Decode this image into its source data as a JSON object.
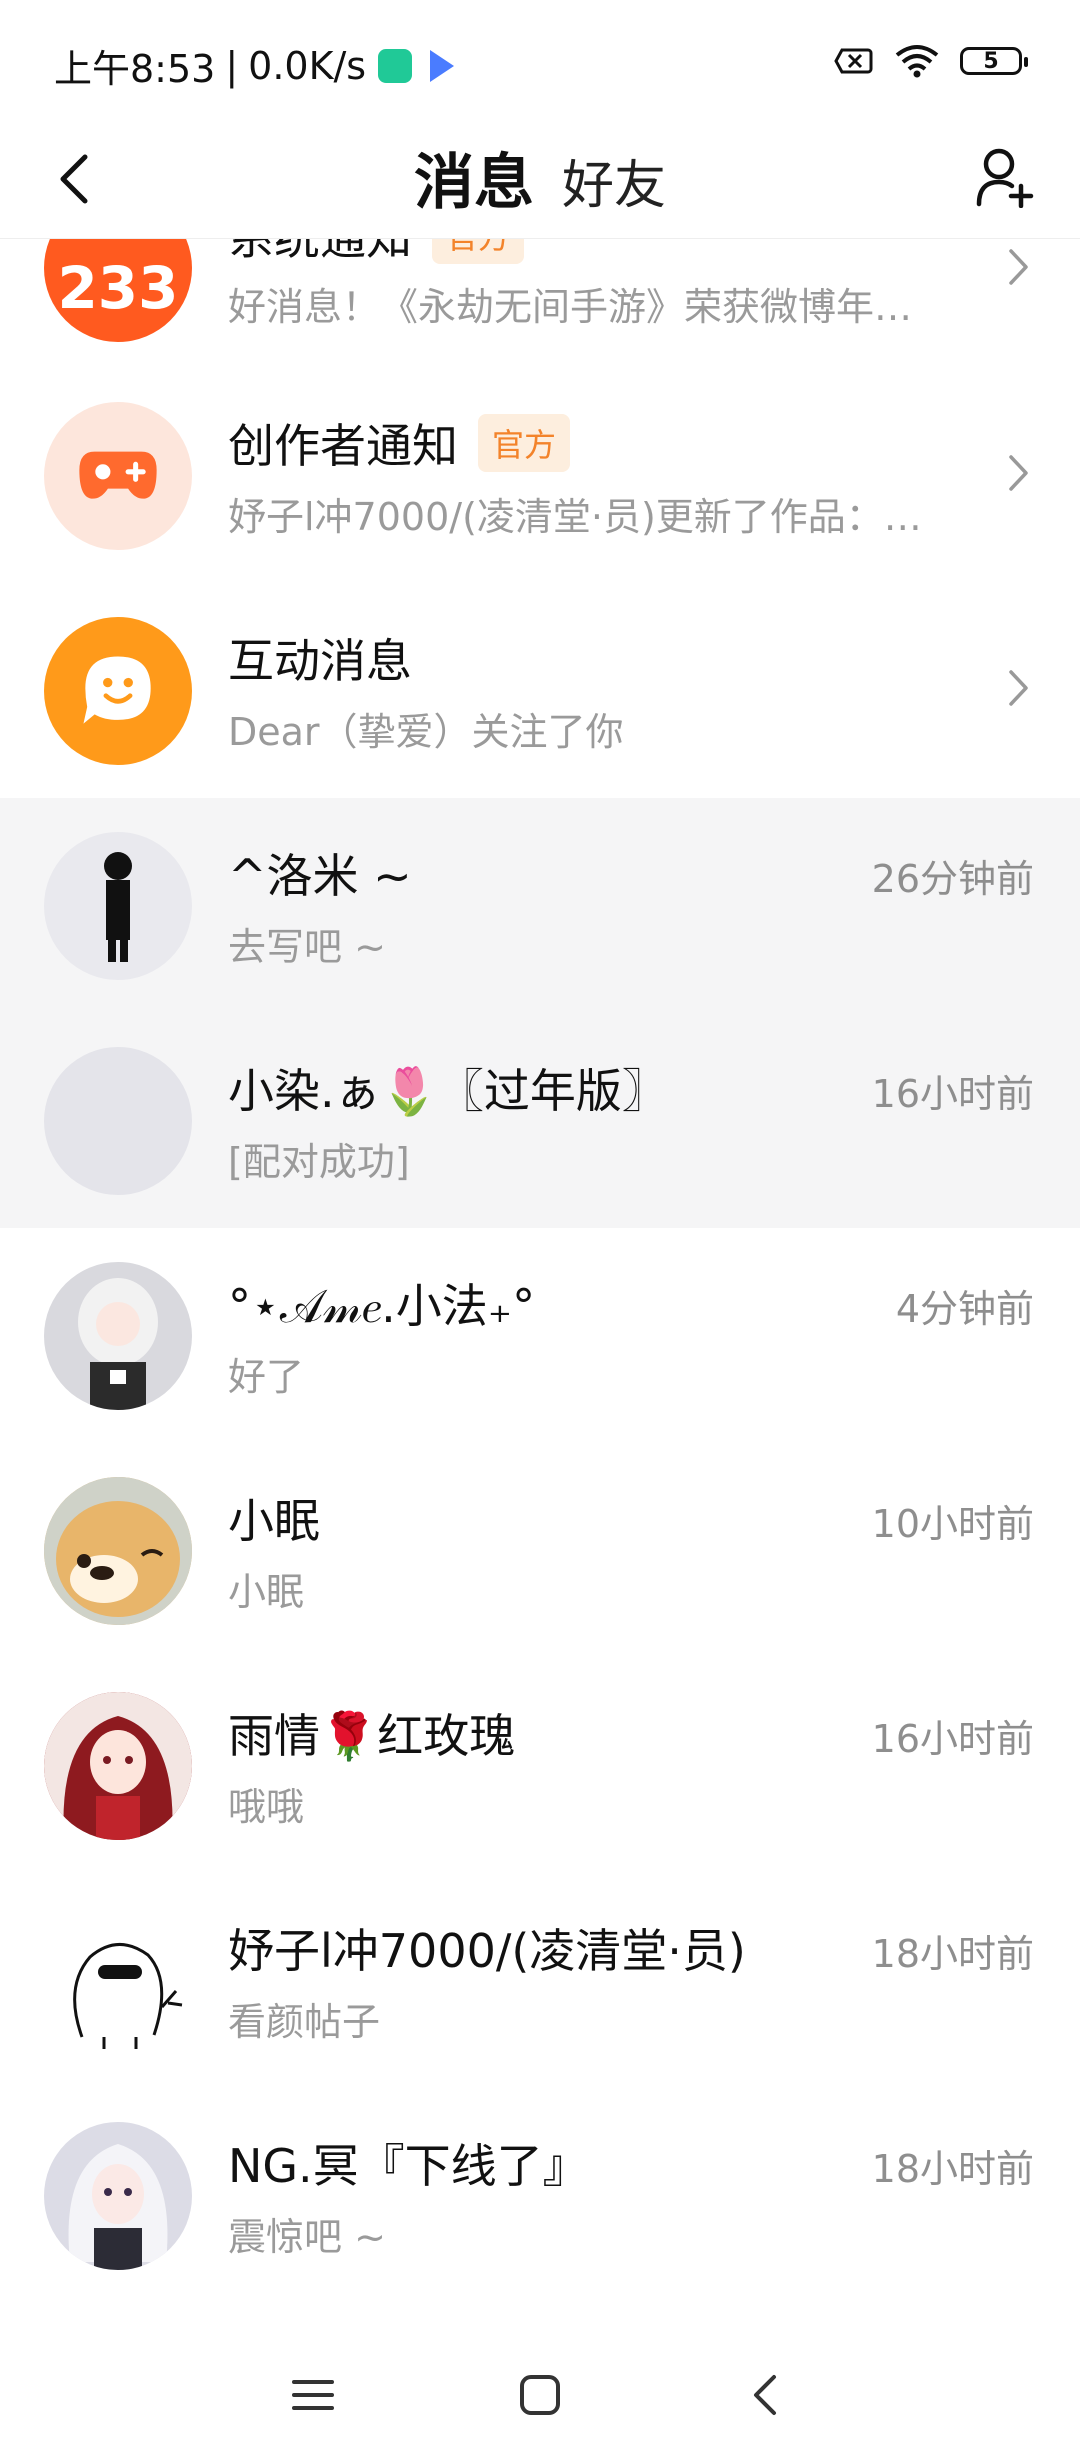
{
  "status_bar": {
    "time": "上午8:53",
    "separator": "|",
    "network_speed": "0.0K/s",
    "battery_level": "5"
  },
  "header": {
    "tabs": [
      {
        "label": "消息",
        "active": true
      },
      {
        "label": "好友",
        "active": false
      }
    ]
  },
  "system_rows": [
    {
      "title": "系统通知",
      "badge": "官方",
      "preview": "好消息！《永劫无间手游》荣获微博年…",
      "avatar_icon": "badge-233-icon",
      "avatar_text": "233",
      "avatar_color": "#ff5a1f"
    },
    {
      "title": "创作者通知",
      "badge": "官方",
      "preview": "妤子l冲7000/(凌清堂·员)更新了作品：…",
      "avatar_icon": "gamepad-icon",
      "avatar_color": "#fde6dc"
    },
    {
      "title": "互动消息",
      "preview": "Dear（挚爱）关注了你",
      "avatar_icon": "chat-bubble-icon",
      "avatar_color": "#ff9a1a"
    }
  ],
  "conversations": [
    {
      "name": "^洛米 ~",
      "preview": "去写吧 ~",
      "time": "26分钟前",
      "pinned": true,
      "avatar_color": "#e9e9ee"
    },
    {
      "name": "小染.ぁ🌷〖过年版〗",
      "preview": "[配对成功]",
      "time": "16小时前",
      "pinned": true,
      "avatar_color": "#e4e4ea"
    },
    {
      "name": "°⋆𝒜𝓂𝑒.小法₊°",
      "preview": "好了",
      "time": "4分钟前",
      "pinned": false,
      "avatar_color": "#d9d9de"
    },
    {
      "name": "小眠",
      "preview": "小眠",
      "time": "10小时前",
      "pinned": false,
      "avatar_color": "#e8b56a"
    },
    {
      "name": "雨情🌹红玫瑰",
      "preview": "哦哦",
      "time": "16小时前",
      "pinned": false,
      "avatar_color": "#9c1b22"
    },
    {
      "name": "妤子l冲7000/(凌清堂·员)",
      "preview": "看颜帖子",
      "time": "18小时前",
      "pinned": false,
      "avatar_color": "#ffffff"
    },
    {
      "name": "NG.冥『下线了』",
      "preview": "震惊吧 ~",
      "time": "18小时前",
      "pinned": false,
      "avatar_color": "#dcdce6"
    }
  ],
  "nav_bar": {
    "buttons": [
      "menu-icon",
      "home-icon",
      "back-icon"
    ]
  }
}
